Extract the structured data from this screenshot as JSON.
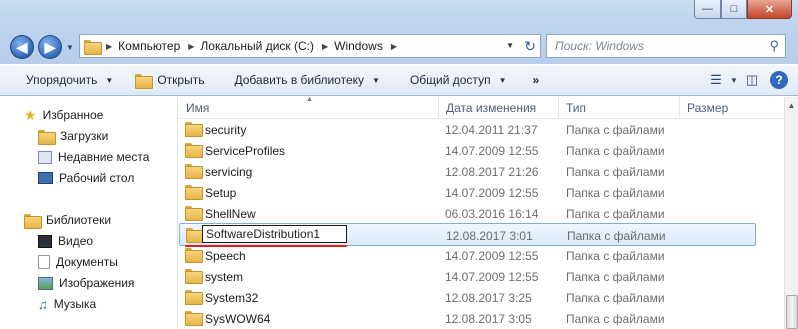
{
  "window": {
    "minimize": "—",
    "maximize": "□",
    "close": "✕"
  },
  "address": {
    "crumbs": [
      "Компьютер",
      "Локальный диск (C:)",
      "Windows"
    ],
    "search_placeholder": "Поиск: Windows"
  },
  "toolbar": {
    "organize": "Упорядочить",
    "open": "Открыть",
    "add_to_library": "Добавить в библиотеку",
    "share": "Общий доступ",
    "more": "»"
  },
  "nav": {
    "favorites": "Избранное",
    "downloads": "Загрузки",
    "recent": "Недавние места",
    "desktop": "Рабочий стол",
    "libraries": "Библиотеки",
    "video": "Видео",
    "documents": "Документы",
    "images": "Изображения",
    "music": "Музыка"
  },
  "columns": {
    "name": "Имя",
    "date": "Дата изменения",
    "type": "Тип",
    "size": "Размер"
  },
  "files": [
    {
      "name": "security",
      "date": "12.04.2011 21:37",
      "type": "Папка с файлами"
    },
    {
      "name": "ServiceProfiles",
      "date": "14.07.2009 12:55",
      "type": "Папка с файлами"
    },
    {
      "name": "servicing",
      "date": "12.08.2017 21:26",
      "type": "Папка с файлами"
    },
    {
      "name": "Setup",
      "date": "14.07.2009 12:55",
      "type": "Папка с файлами"
    },
    {
      "name": "ShellNew",
      "date": "06.03.2016 16:14",
      "type": "Папка с файлами"
    },
    {
      "name": "SoftwareDistribution1",
      "date": "12.08.2017 3:01",
      "type": "Папка с файлами"
    },
    {
      "name": "Speech",
      "date": "14.07.2009 12:55",
      "type": "Папка с файлами"
    },
    {
      "name": "system",
      "date": "14.07.2009 12:55",
      "type": "Папка с файлами"
    },
    {
      "name": "System32",
      "date": "12.08.2017 3:25",
      "type": "Папка с файлами"
    },
    {
      "name": "SysWOW64",
      "date": "12.08.2017 3:05",
      "type": "Папка с файлами"
    }
  ],
  "colors": {
    "accent": "#3b73c4",
    "selection": "#dce9f8",
    "underline": "#e11d1d"
  }
}
